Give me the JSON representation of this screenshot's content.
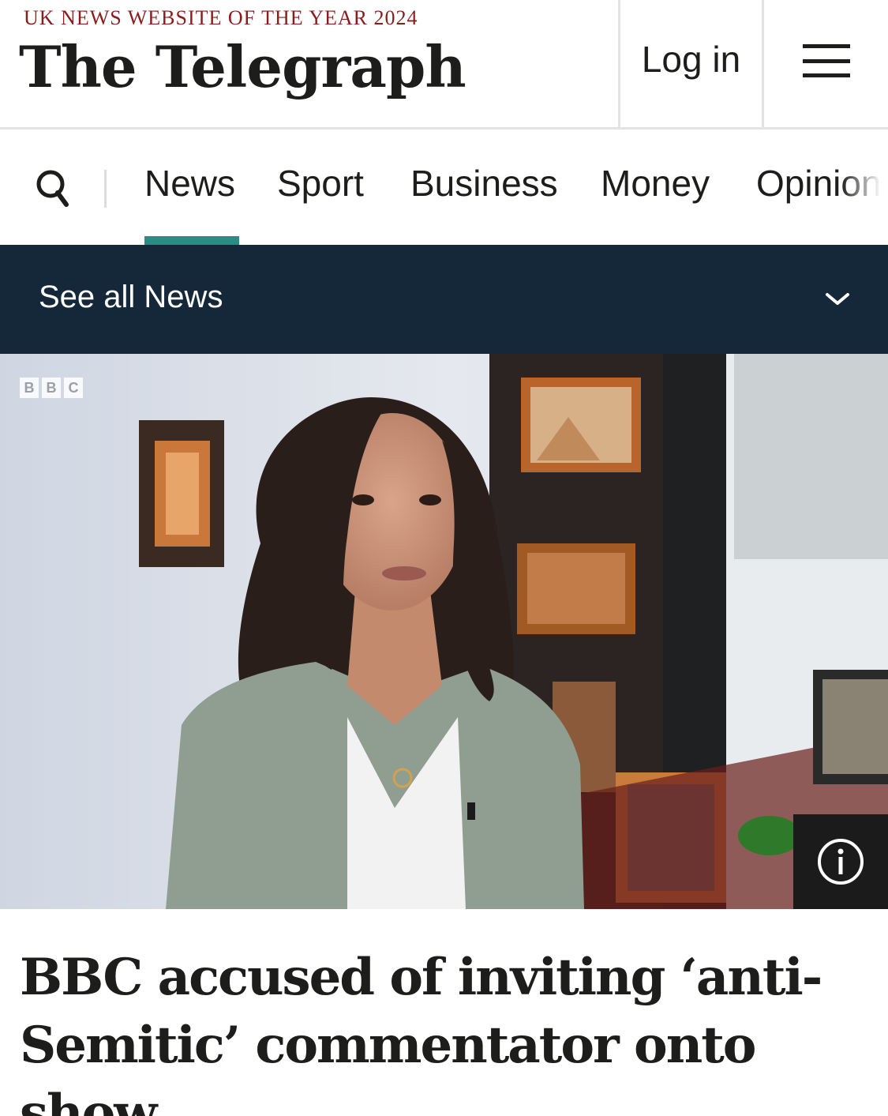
{
  "header": {
    "tagline": "UK NEWS WEBSITE OF THE YEAR 2024",
    "brand": "The Telegraph",
    "login_label": "Log in",
    "menu_icon": "hamburger-menu-icon"
  },
  "nav": {
    "search_icon": "search-icon",
    "items": [
      {
        "label": "News",
        "active": true
      },
      {
        "label": "Sport",
        "active": false
      },
      {
        "label": "Business",
        "active": false
      },
      {
        "label": "Money",
        "active": false
      },
      {
        "label": "Opinion",
        "active": false
      }
    ],
    "accent_color": "#2e8b83"
  },
  "subnav": {
    "label": "See all News",
    "background": "#15283a"
  },
  "hero": {
    "logo_letters": [
      "B",
      "B",
      "C"
    ],
    "info_icon": "info-icon"
  },
  "article": {
    "headline": "BBC accused of inviting ‘anti-Semitic’ commentator onto show"
  }
}
